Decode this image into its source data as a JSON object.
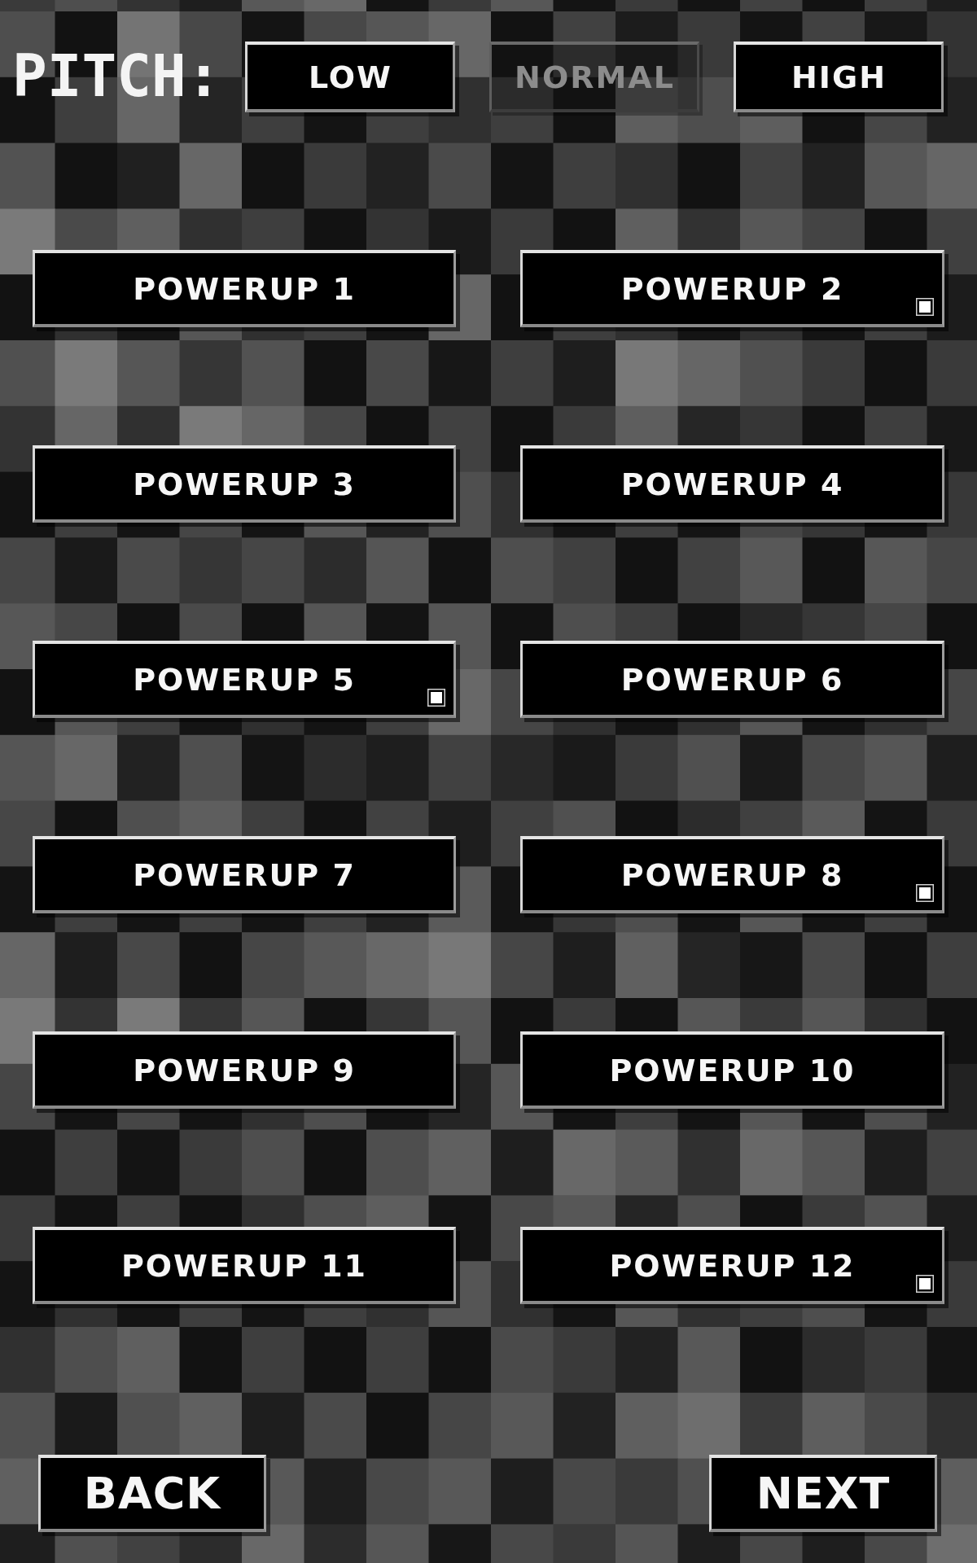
{
  "pitch": {
    "label": "PITCH:",
    "options": [
      {
        "label": "LOW",
        "selected": false
      },
      {
        "label": "NORMAL",
        "selected": true
      },
      {
        "label": "HIGH",
        "selected": false
      }
    ]
  },
  "powerups": [
    {
      "label": "POWERUP 1",
      "marked": false
    },
    {
      "label": "POWERUP 2",
      "marked": true
    },
    {
      "label": "POWERUP 3",
      "marked": false
    },
    {
      "label": "POWERUP 4",
      "marked": false
    },
    {
      "label": "POWERUP 5",
      "marked": true
    },
    {
      "label": "POWERUP 6",
      "marked": false
    },
    {
      "label": "POWERUP 7",
      "marked": false
    },
    {
      "label": "POWERUP 8",
      "marked": true
    },
    {
      "label": "POWERUP 9",
      "marked": false
    },
    {
      "label": "POWERUP 10",
      "marked": false
    },
    {
      "label": "POWERUP 11",
      "marked": false
    },
    {
      "label": "POWERUP 12",
      "marked": true
    }
  ],
  "back_button": {
    "label": "BACK"
  },
  "next_button": {
    "label": "NEXT"
  }
}
